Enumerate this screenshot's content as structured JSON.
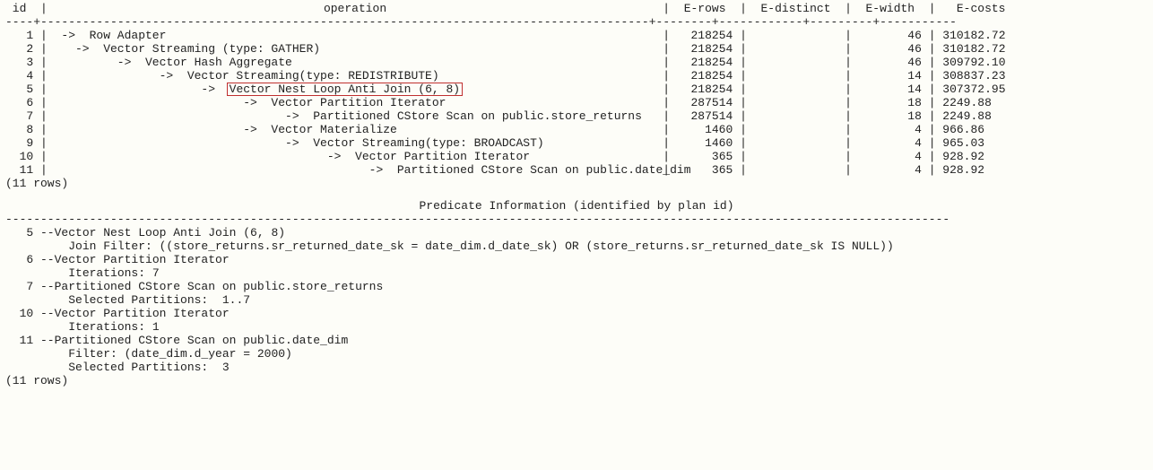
{
  "table": {
    "headers": {
      "id": " id ",
      "operation": "operation",
      "erows": "E-rows",
      "edistinct": "E-distinct",
      "ewidth": "E-width",
      "ecosts": "E-costs"
    },
    "separator_top": "----+---------------------------------------------------------------------------------------+--------+------------+---------+-----------",
    "rows": [
      {
        "id": "1",
        "indent": " ->  Row Adapter",
        "erows": "218254",
        "edist": "",
        "ewidth": "46",
        "ecost": "310182.72",
        "hl": false
      },
      {
        "id": "2",
        "indent": "   ->  Vector Streaming (type: GATHER)",
        "erows": "218254",
        "edist": "",
        "ewidth": "46",
        "ecost": "310182.72",
        "hl": false
      },
      {
        "id": "3",
        "indent": "         ->  Vector Hash Aggregate",
        "erows": "218254",
        "edist": "",
        "ewidth": "46",
        "ecost": "309792.10",
        "hl": false
      },
      {
        "id": "4",
        "indent": "               ->  Vector Streaming(type: REDISTRIBUTE)",
        "erows": "218254",
        "edist": "",
        "ewidth": "14",
        "ecost": "308837.23",
        "hl": false
      },
      {
        "id": "5",
        "indent": "                     ->  ",
        "hl_text": "Vector Nest Loop Anti Join (6, 8)",
        "erows": "218254",
        "edist": "",
        "ewidth": "14",
        "ecost": "307372.95",
        "hl": true
      },
      {
        "id": "6",
        "indent": "                           ->  Vector Partition Iterator",
        "erows": "287514",
        "edist": "",
        "ewidth": "18",
        "ecost": "2249.88",
        "hl": false
      },
      {
        "id": "7",
        "indent": "                                 ->  Partitioned CStore Scan on public.store_returns",
        "erows": "287514",
        "edist": "",
        "ewidth": "18",
        "ecost": "2249.88",
        "hl": false
      },
      {
        "id": "8",
        "indent": "                           ->  Vector Materialize",
        "erows": "1460",
        "edist": "",
        "ewidth": "4",
        "ecost": "966.86",
        "hl": false
      },
      {
        "id": "9",
        "indent": "                                 ->  Vector Streaming(type: BROADCAST)",
        "erows": "1460",
        "edist": "",
        "ewidth": "4",
        "ecost": "965.03",
        "hl": false
      },
      {
        "id": "10",
        "indent": "                                       ->  Vector Partition Iterator",
        "erows": "365",
        "edist": "",
        "ewidth": "4",
        "ecost": "928.92",
        "hl": false
      },
      {
        "id": "11",
        "indent": "                                             ->  Partitioned CStore Scan on public.date_dim",
        "erows": "365",
        "edist": "",
        "ewidth": "4",
        "ecost": "928.92",
        "hl": false
      }
    ],
    "rowcount1": "(11 rows)"
  },
  "predicate": {
    "title": "Predicate Information (identified by plan id)",
    "separator": "---------------------------------------------------------------------------------------------------------------------------------------",
    "lines": [
      "   5 --Vector Nest Loop Anti Join (6, 8)",
      "         Join Filter: ((store_returns.sr_returned_date_sk = date_dim.d_date_sk) OR (store_returns.sr_returned_date_sk IS NULL))",
      "   6 --Vector Partition Iterator",
      "         Iterations: 7",
      "   7 --Partitioned CStore Scan on public.store_returns",
      "         Selected Partitions:  1..7",
      "  10 --Vector Partition Iterator",
      "         Iterations: 1",
      "  11 --Partitioned CStore Scan on public.date_dim",
      "         Filter: (date_dim.d_year = 2000)",
      "         Selected Partitions:  3"
    ],
    "rowcount2": "(11 rows)"
  }
}
